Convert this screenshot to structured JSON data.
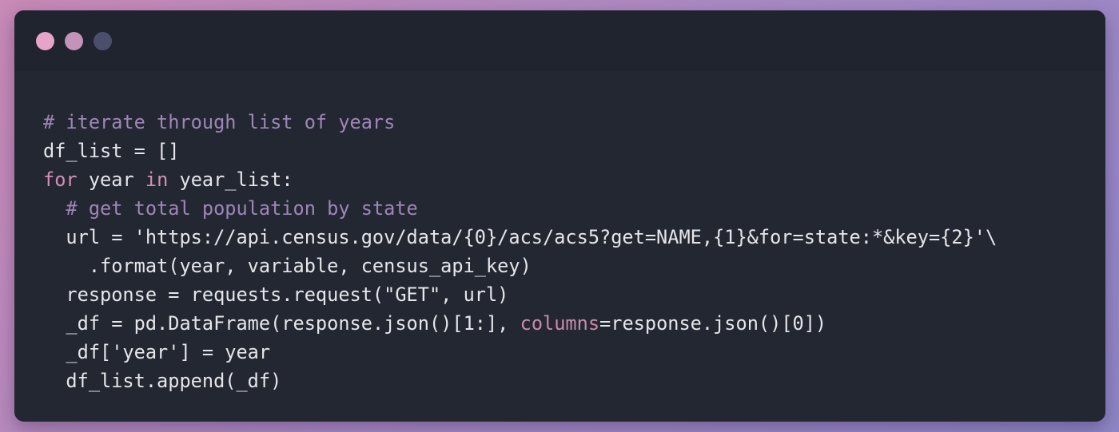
{
  "window": {
    "controls": [
      {
        "name": "close-dot",
        "color": "#e6a5c8"
      },
      {
        "name": "minimize-dot",
        "color": "#c493b9"
      },
      {
        "name": "maximize-dot",
        "color": "#4a4f6b"
      }
    ]
  },
  "colors": {
    "comment": "#9f86b8",
    "keyword": "#d58fb8",
    "kwarg": "#c98aad",
    "text": "#e6e6ea",
    "editor_background": "#222731",
    "titlebar_background": "#1f242e"
  },
  "code": {
    "language": "python",
    "lines": [
      [
        {
          "t": "# iterate through list of years",
          "k": "comment"
        }
      ],
      [
        {
          "t": "df_list = []",
          "k": "plain"
        }
      ],
      [
        {
          "t": "for",
          "k": "keyword"
        },
        {
          "t": " year ",
          "k": "plain"
        },
        {
          "t": "in",
          "k": "keyword"
        },
        {
          "t": " year_list:",
          "k": "plain"
        }
      ],
      [
        {
          "t": "  ",
          "k": "plain"
        },
        {
          "t": "# get total population by state",
          "k": "comment"
        }
      ],
      [
        {
          "t": "  url = 'https://api.census.gov/data/{0}/acs/acs5?get=NAME,{1}&for=state:*&key={2}'\\",
          "k": "plain"
        }
      ],
      [
        {
          "t": "    .format(year, variable, census_api_key)",
          "k": "plain"
        }
      ],
      [
        {
          "t": "  response = requests.request(\"GET\", url)",
          "k": "plain"
        }
      ],
      [
        {
          "t": "  _df = pd.DataFrame(response.json()[1:], ",
          "k": "plain"
        },
        {
          "t": "columns",
          "k": "kwarg"
        },
        {
          "t": "=response.json()[0])",
          "k": "plain"
        }
      ],
      [
        {
          "t": "  _df['year'] = year",
          "k": "plain"
        }
      ],
      [
        {
          "t": "  df_list.append(_df)",
          "k": "plain"
        }
      ]
    ]
  }
}
